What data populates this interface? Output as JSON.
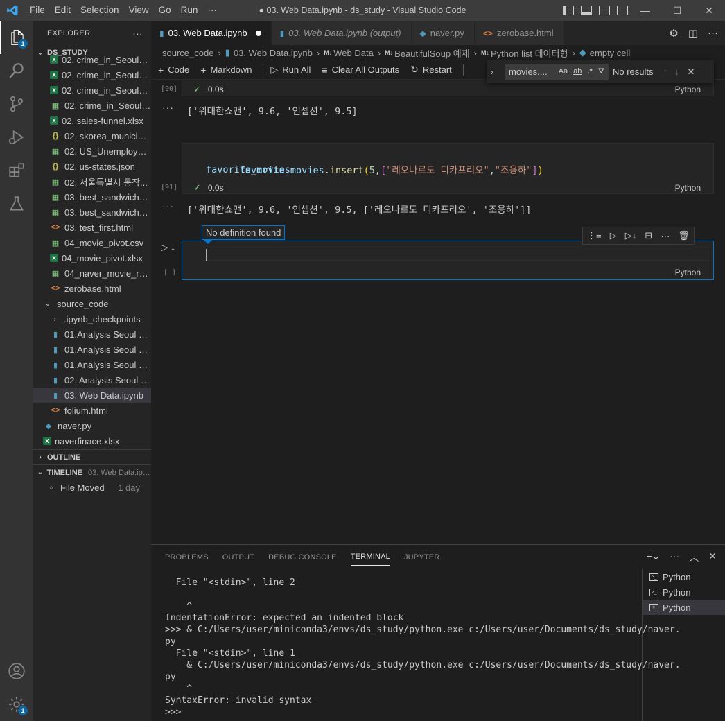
{
  "titlebar": {
    "menu": [
      "File",
      "Edit",
      "Selection",
      "View",
      "Go",
      "Run",
      "···"
    ],
    "title": "● 03. Web Data.ipynb - ds_study - Visual Studio Code"
  },
  "activity": {
    "explorer_badge": "1",
    "settings_badge": "1"
  },
  "sidebar": {
    "header": "EXPLORER",
    "more": "···",
    "folder": "DS_STUDY",
    "items": [
      {
        "name": "02. crime_in_Seoul_i...",
        "type": "xlsx",
        "indent": 1
      },
      {
        "name": "02. crime_in_Seoul_l...",
        "type": "xlsx",
        "indent": 1
      },
      {
        "name": "02. crime_in_Seoul_r...",
        "type": "xlsx",
        "indent": 1
      },
      {
        "name": "02. crime_in_Seoul.csv",
        "type": "csv",
        "indent": 1
      },
      {
        "name": "02. sales-funnel.xlsx",
        "type": "xlsx",
        "indent": 1
      },
      {
        "name": "02. skorea_municipa...",
        "type": "json",
        "indent": 1
      },
      {
        "name": "02. US_Unemploym...",
        "type": "csv",
        "indent": 1
      },
      {
        "name": "02. us-states.json",
        "type": "json",
        "indent": 1
      },
      {
        "name": "02. 서울특별시 동작...",
        "type": "csv",
        "indent": 1
      },
      {
        "name": "03. best_sandwiches...",
        "type": "csv",
        "indent": 1
      },
      {
        "name": "03. best_sandwiches...",
        "type": "csv",
        "indent": 1
      },
      {
        "name": "03. test_first.html",
        "type": "html",
        "indent": 1
      },
      {
        "name": "04_movie_pivot.csv",
        "type": "csv",
        "indent": 1
      },
      {
        "name": "04_movie_pivot.xlsx",
        "type": "xlsx",
        "indent": 1
      },
      {
        "name": "04_naver_movie_raw...",
        "type": "csv",
        "indent": 1
      },
      {
        "name": "zerobase.html",
        "type": "html",
        "indent": 1
      },
      {
        "name": "source_code",
        "type": "folder-open",
        "indent": 0
      },
      {
        "name": ".ipynb_checkpoints",
        "type": "folder-closed",
        "indent": 1
      },
      {
        "name": "01.Analysis Seoul CC...",
        "type": "nb",
        "indent": 1
      },
      {
        "name": "01.Analysis Seoul CC...",
        "type": "nb",
        "indent": 1
      },
      {
        "name": "01.Analysis Seoul CC...",
        "type": "nb",
        "indent": 1
      },
      {
        "name": "02. Analysis Seoul Cr...",
        "type": "nb",
        "indent": 1
      },
      {
        "name": "03. Web Data.ipynb",
        "type": "nb",
        "indent": 1,
        "selected": true
      },
      {
        "name": "folium.html",
        "type": "html",
        "indent": 1
      },
      {
        "name": "naver.py",
        "type": "py",
        "indent": 0
      },
      {
        "name": "naverfinace.xlsx",
        "type": "xlsx",
        "indent": 0
      }
    ],
    "outline": "OUTLINE",
    "timeline": "TIMELINE",
    "timeline_file": "03. Web Data.ipy...",
    "timeline_event": "File Moved",
    "timeline_when": "1 day"
  },
  "tabs": [
    {
      "label": "03. Web Data.ipynb",
      "icon": "nb",
      "active": true,
      "dirty": true
    },
    {
      "label": "03. Web Data.ipynb (output)",
      "icon": "nb",
      "italic": true
    },
    {
      "label": "naver.py",
      "icon": "py"
    },
    {
      "label": "zerobase.html",
      "icon": "html"
    }
  ],
  "breadcrumb": {
    "folder": "source_code",
    "file": "03. Web Data.ipynb",
    "md1_prefix": "M↓",
    "md1": "Web Data",
    "md2_prefix": "M↓",
    "md2": "BeautifulSoup 예제",
    "md3_prefix": "M↓",
    "md3": "Python list 데이터형",
    "cell": "empty cell"
  },
  "notebook_toolbar": {
    "code": "Code",
    "markdown": "Markdown",
    "run_all": "Run All",
    "clear_outputs": "Clear All Outputs",
    "restart": "Restart"
  },
  "find": {
    "query": "movies....",
    "opt_case": "Aa",
    "opt_word": "ab",
    "opt_regex": ".*",
    "results": "No results"
  },
  "cells": {
    "c90": {
      "count": "[90]",
      "time": "0.0s",
      "lang": "Python",
      "output": "['위대한쇼맨', 9.6, '인셉션', 9.5]"
    },
    "c91": {
      "count": "[91]",
      "time": "0.0s",
      "lang": "Python",
      "line1_var": "favorite_movies",
      "line1_dot": ".",
      "line1_fn": "insert",
      "line1_open": "(",
      "line1_num": "5",
      "line1_comma": ",",
      "line1_lb": "[",
      "line1_s1": "\"레오나르도 디카프리오\"",
      "line1_comma2": ",",
      "line1_s2": "\"조용하\"",
      "line1_rb": "]",
      "line1_close": ")",
      "line2": "favorite_movies",
      "output": "['위대한쇼맨', 9.6, '인셉션', 9.5, ['레오나르도 디카프리오', '조용하']]"
    },
    "empty": {
      "count": "[ ]",
      "lang": "Python"
    }
  },
  "tooltip": "No definition found",
  "panel": {
    "tabs": [
      "PROBLEMS",
      "OUTPUT",
      "DEBUG CONSOLE",
      "TERMINAL",
      "JUPYTER"
    ],
    "active_tab": "TERMINAL",
    "terminal_lines": [
      "  File \"<stdin>\", line 2",
      "",
      "    ^",
      "IndentationError: expected an indented block",
      ">>> & C:/Users/user/miniconda3/envs/ds_study/python.exe c:/Users/user/Documents/ds_study/naver.",
      "py",
      "  File \"<stdin>\", line 1",
      "    & C:/Users/user/miniconda3/envs/ds_study/python.exe c:/Users/user/Documents/ds_study/naver.",
      "py",
      "    ^",
      "SyntaxError: invalid syntax",
      ">>>"
    ],
    "terminals": [
      "Python",
      "Python",
      "Python"
    ]
  }
}
